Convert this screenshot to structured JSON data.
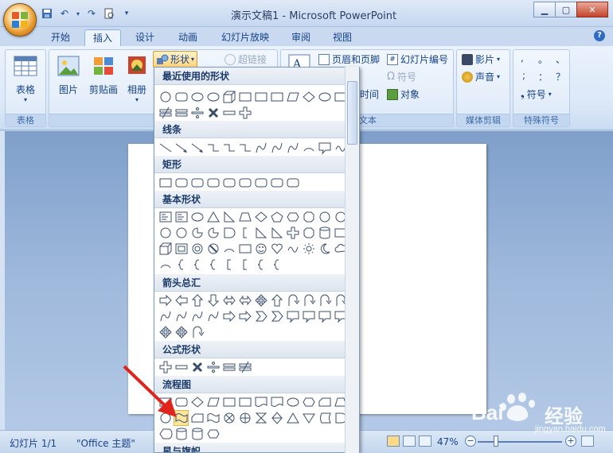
{
  "window": {
    "title": "演示文稿1 - Microsoft PowerPoint",
    "controls": [
      "minimize",
      "maximize",
      "close"
    ]
  },
  "quick_access": [
    "save-icon",
    "undo-icon",
    "redo-icon",
    "print-preview-icon",
    "customize-icon"
  ],
  "tabs": [
    "开始",
    "插入",
    "设计",
    "动画",
    "幻灯片放映",
    "审阅",
    "视图"
  ],
  "active_tab": "插入",
  "ribbon": {
    "groups": {
      "table": {
        "label": "表格",
        "button": "表格"
      },
      "illustrations": {
        "label": "插图",
        "buttons": [
          "图片",
          "剪贴画",
          "相册"
        ],
        "shapes": "形状"
      },
      "links": {
        "hyperlink": "超链接"
      },
      "text": {
        "label": "文本",
        "header_footer": "页眉和页脚",
        "slide_number": "幻灯片编号",
        "symbol": "符号",
        "datetime": "时间",
        "object": "对象"
      },
      "media": {
        "label": "媒体剪辑",
        "movie": "影片",
        "sound": "声音"
      },
      "special": {
        "label": "特殊符号",
        "symbol": "符号",
        "chars": [
          ",",
          "。",
          "、",
          ";",
          "：",
          "？"
        ]
      }
    }
  },
  "gallery": {
    "categories": [
      "最近使用的形状",
      "线条",
      "矩形",
      "基本形状",
      "箭头总汇",
      "公式形状",
      "流程图",
      "星与旗帜"
    ],
    "highlighted": "流程图-资料带"
  },
  "statusbar": {
    "slide": "幻灯片 1/1",
    "theme": "\"Office 主题\"",
    "zoom": "47%"
  },
  "watermark": {
    "brand": "Bai",
    "suffix": "经验",
    "url": "jingyan.baidu.com"
  },
  "colors": {
    "accent": "#15428b",
    "ribbon_bg": "#dbe8f8",
    "highlight": "#ffe69d",
    "arrow": "#e0241b"
  }
}
